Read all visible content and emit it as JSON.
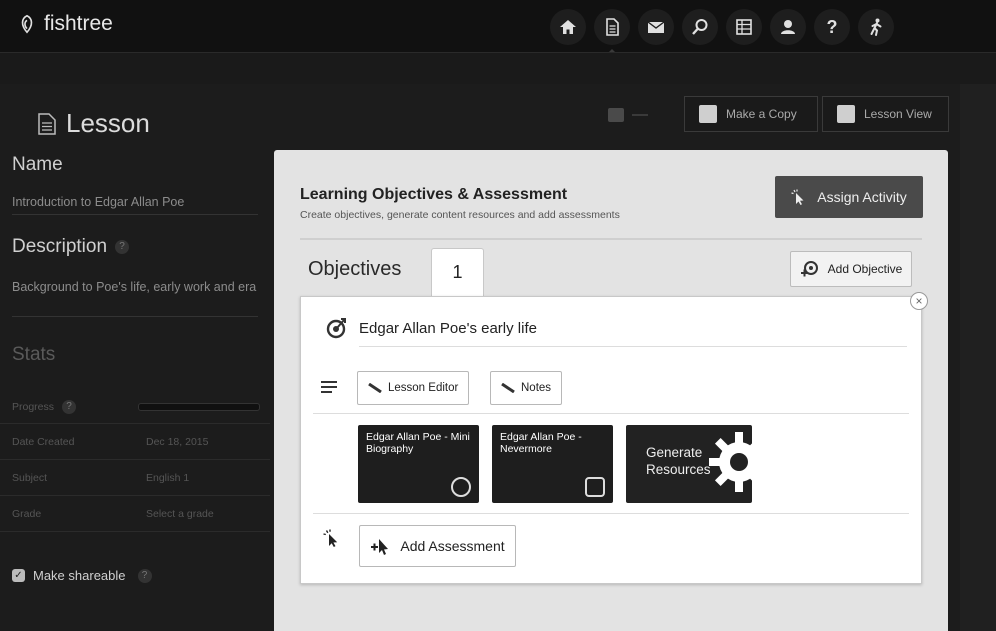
{
  "app": {
    "name": "fishtree"
  },
  "nav": [
    {
      "icon": "home-icon",
      "active": false
    },
    {
      "icon": "document-icon",
      "active": true
    },
    {
      "icon": "mail-icon",
      "active": false
    },
    {
      "icon": "search-icon",
      "active": false
    },
    {
      "icon": "list-icon",
      "active": false
    },
    {
      "icon": "user-icon",
      "active": false
    },
    {
      "icon": "help-icon",
      "label": "?",
      "active": false
    },
    {
      "icon": "walking-icon",
      "active": false
    }
  ],
  "page": {
    "title": "Lesson"
  },
  "toolbar": {
    "copy_label": "Make a Copy",
    "view_label": "Lesson View"
  },
  "sidebar": {
    "name_label": "Name",
    "name_value": "Introduction to Edgar Allan Poe",
    "description_label": "Description",
    "description_help": "?",
    "description_value": "Background to Poe's life, early work and era",
    "stats_label": "Stats",
    "stats": [
      {
        "key": "Progress",
        "help": "?",
        "progress": 0
      },
      {
        "key": "Date Created",
        "value": "Dec 18, 2015"
      },
      {
        "key": "Subject",
        "value": "English 1"
      },
      {
        "key": "Grade",
        "value": "Select a grade"
      }
    ],
    "shareable_label": "Make shareable",
    "shareable_checked": true,
    "shareable_help": "?"
  },
  "panel": {
    "title": "Learning Objectives & Assessment",
    "subtitle": "Create objectives, generate content resources and add assessments",
    "assign_label": "Assign Activity",
    "objectives_label": "Objectives",
    "tab_number": "1",
    "add_objective_label": "Add Objective",
    "close_symbol": "×",
    "objective": {
      "title": "Edgar Allan Poe's early life",
      "lesson_editor_label": "Lesson Editor",
      "notes_label": "Notes",
      "resources": [
        {
          "title": "Edgar Allan Poe - Mini Biography",
          "type": "video"
        },
        {
          "title": "Edgar Allan Poe - Nevermore",
          "type": "document"
        }
      ],
      "generate_label": "Generate Resources",
      "add_assessment_label": "Add Assessment"
    }
  },
  "colors": {
    "background": "#1c1c1c",
    "panel": "#e3e3e3",
    "accent_dark": "#4a4a4a"
  }
}
